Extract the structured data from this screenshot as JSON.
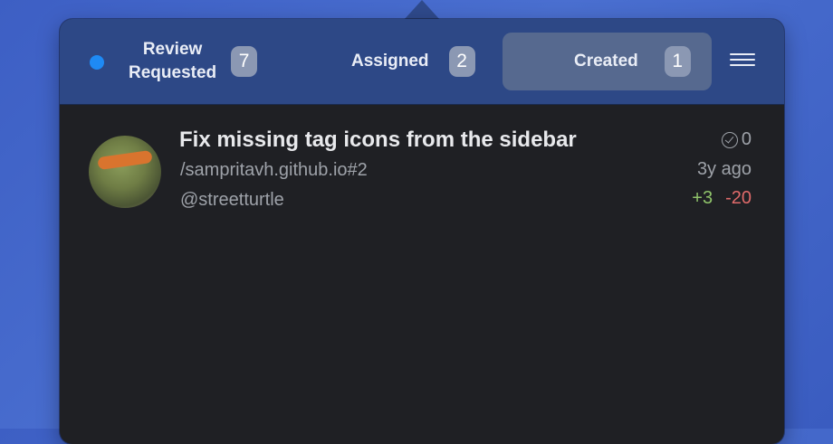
{
  "tabs": [
    {
      "label_line1": "Review",
      "label_line2": "Requested",
      "count": "7"
    },
    {
      "label": "Assigned",
      "count": "2"
    },
    {
      "label": "Created",
      "count": "1"
    }
  ],
  "pull_request": {
    "title": "Fix missing tag icons from the sidebar",
    "repo": "/sampritavh.github.io#2",
    "author": "@streetturtle",
    "checks": "0",
    "age": "3y ago",
    "additions": "+3",
    "deletions": "-20"
  },
  "colors": {
    "accent_dot": "#1e8af5",
    "additions": "#8fc36a",
    "deletions": "#e06a6a"
  }
}
